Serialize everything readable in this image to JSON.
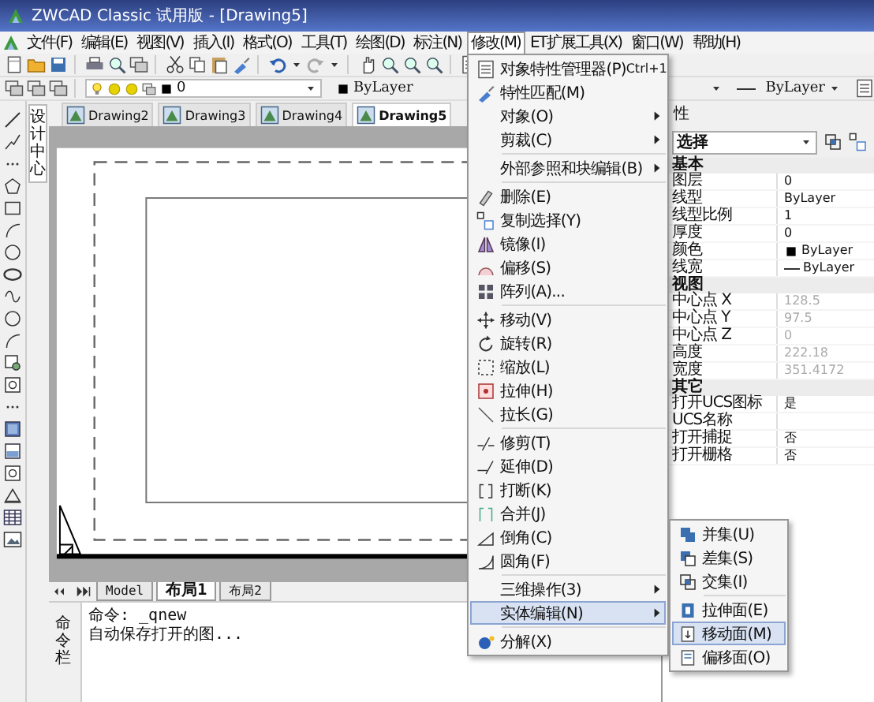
{
  "window": {
    "title": "ZWCAD Classic 试用版 - [Drawing5]"
  },
  "menu_bar": [
    {
      "label": "文件(F)",
      "selected": false
    },
    {
      "label": "编辑(E)",
      "selected": false
    },
    {
      "label": "视图(V)",
      "selected": false
    },
    {
      "label": "插入(I)",
      "selected": false
    },
    {
      "label": "格式(O)",
      "selected": false
    },
    {
      "label": "工具(T)",
      "selected": false
    },
    {
      "label": "绘图(D)",
      "selected": false
    },
    {
      "label": "标注(N)",
      "selected": false
    },
    {
      "label": "修改(M)",
      "selected": true
    },
    {
      "label": "ET扩展工具(X)",
      "selected": false
    },
    {
      "label": "窗口(W)",
      "selected": false
    },
    {
      "label": "帮助(H)",
      "selected": false
    }
  ],
  "layer_combo": {
    "value": "0"
  },
  "color_combo": {
    "value": "ByLayer"
  },
  "linetype_combo": {
    "value": "ByLayer"
  },
  "side_tab": {
    "label": "设计中心"
  },
  "drawing_tabs": [
    {
      "label": "Drawing2",
      "selected": false
    },
    {
      "label": "Drawing3",
      "selected": false
    },
    {
      "label": "Drawing4",
      "selected": false
    },
    {
      "label": "Drawing5",
      "selected": true
    }
  ],
  "layout_tabs": [
    {
      "label": "Model",
      "selected": false
    },
    {
      "label": "布局1",
      "selected": true
    },
    {
      "label": "布局2",
      "selected": false
    }
  ],
  "command_window": {
    "label": "命令栏",
    "lines": [
      "命令:  _qnew",
      "自动保存打开的图..."
    ]
  },
  "properties": {
    "title": "性",
    "selection": "选择",
    "sections": [
      {
        "title": "基本",
        "rows": [
          {
            "name": "图层",
            "value": "0",
            "kind": "text",
            "disabled": false
          },
          {
            "name": "线型",
            "value": "ByLayer",
            "kind": "text",
            "disabled": false
          },
          {
            "name": "线型比例",
            "value": "1",
            "kind": "text",
            "disabled": false
          },
          {
            "name": "厚度",
            "value": "0",
            "kind": "text",
            "disabled": false
          },
          {
            "name": "颜色",
            "value": "ByLayer",
            "kind": "color",
            "disabled": false
          },
          {
            "name": "线宽",
            "value": "ByLayer",
            "kind": "lineweight",
            "disabled": false
          }
        ]
      },
      {
        "title": "视图",
        "rows": [
          {
            "name": "中心点 X",
            "value": "128.5",
            "kind": "text",
            "disabled": true
          },
          {
            "name": "中心点 Y",
            "value": "97.5",
            "kind": "text",
            "disabled": true
          },
          {
            "name": "中心点 Z",
            "value": "0",
            "kind": "text",
            "disabled": true
          },
          {
            "name": "高度",
            "value": "222.18",
            "kind": "text",
            "disabled": true
          },
          {
            "name": "宽度",
            "value": "351.4172",
            "kind": "text",
            "disabled": true
          }
        ]
      },
      {
        "title": "其它",
        "rows": [
          {
            "name": "打开UCS图标",
            "value": "是",
            "kind": "text",
            "disabled": false
          },
          {
            "name": "UCS名称",
            "kind": "text"
          },
          {
            "name": "打开捕捉",
            "value": "否",
            "kind": "text",
            "disabled": false
          },
          {
            "name": "打开栅格",
            "value": "否",
            "kind": "text",
            "disabled": false
          }
        ]
      }
    ]
  },
  "modify_menu": {
    "items": [
      {
        "kind": "item",
        "label": "对象特性管理器(P)",
        "shortcut": "Ctrl+1",
        "submenu": false,
        "selected": false
      },
      {
        "kind": "item",
        "label": "特性匹配(M)",
        "submenu": false,
        "selected": false
      },
      {
        "kind": "item",
        "label": "对象(O)",
        "submenu": true,
        "selected": false
      },
      {
        "kind": "item",
        "label": "剪裁(C)",
        "submenu": true,
        "selected": false
      },
      {
        "kind": "separator"
      },
      {
        "kind": "item",
        "label": "外部参照和块编辑(B)",
        "submenu": true,
        "selected": false
      },
      {
        "kind": "separator"
      },
      {
        "kind": "item",
        "label": "删除(E)",
        "submenu": false,
        "selected": false
      },
      {
        "kind": "item",
        "label": "复制选择(Y)",
        "submenu": false,
        "selected": false
      },
      {
        "kind": "item",
        "label": "镜像(I)",
        "submenu": false,
        "selected": false
      },
      {
        "kind": "item",
        "label": "偏移(S)",
        "submenu": false,
        "selected": false
      },
      {
        "kind": "item",
        "label": "阵列(A)...",
        "submenu": false,
        "selected": false
      },
      {
        "kind": "separator"
      },
      {
        "kind": "item",
        "label": "移动(V)",
        "submenu": false,
        "selected": false
      },
      {
        "kind": "item",
        "label": "旋转(R)",
        "submenu": false,
        "selected": false
      },
      {
        "kind": "item",
        "label": "缩放(L)",
        "submenu": false,
        "selected": false
      },
      {
        "kind": "item",
        "label": "拉伸(H)",
        "submenu": false,
        "selected": false
      },
      {
        "kind": "item",
        "label": "拉长(G)",
        "submenu": false,
        "selected": false
      },
      {
        "kind": "separator"
      },
      {
        "kind": "item",
        "label": "修剪(T)",
        "submenu": false,
        "selected": false
      },
      {
        "kind": "item",
        "label": "延伸(D)",
        "submenu": false,
        "selected": false
      },
      {
        "kind": "item",
        "label": "打断(K)",
        "submenu": false,
        "selected": false
      },
      {
        "kind": "item",
        "label": "合并(J)",
        "submenu": false,
        "selected": false
      },
      {
        "kind": "item",
        "label": "倒角(C)",
        "submenu": false,
        "selected": false
      },
      {
        "kind": "item",
        "label": "圆角(F)",
        "submenu": false,
        "selected": false
      },
      {
        "kind": "separator"
      },
      {
        "kind": "item",
        "label": "三维操作(3)",
        "submenu": true,
        "selected": false
      },
      {
        "kind": "item",
        "label": "实体编辑(N)",
        "submenu": true,
        "selected": true
      },
      {
        "kind": "separator"
      },
      {
        "kind": "item",
        "label": "分解(X)",
        "submenu": false,
        "selected": false
      }
    ]
  },
  "solid_edit_menu": {
    "items": [
      {
        "kind": "item",
        "label": "并集(U)",
        "selected": false
      },
      {
        "kind": "item",
        "label": "差集(S)",
        "selected": false
      },
      {
        "kind": "item",
        "label": "交集(I)",
        "selected": false
      },
      {
        "kind": "separator"
      },
      {
        "kind": "item",
        "label": "拉伸面(E)",
        "selected": false
      },
      {
        "kind": "item",
        "label": "移动面(M)",
        "selected": true
      },
      {
        "kind": "item",
        "label": "偏移面(O)",
        "selected": false
      }
    ]
  }
}
